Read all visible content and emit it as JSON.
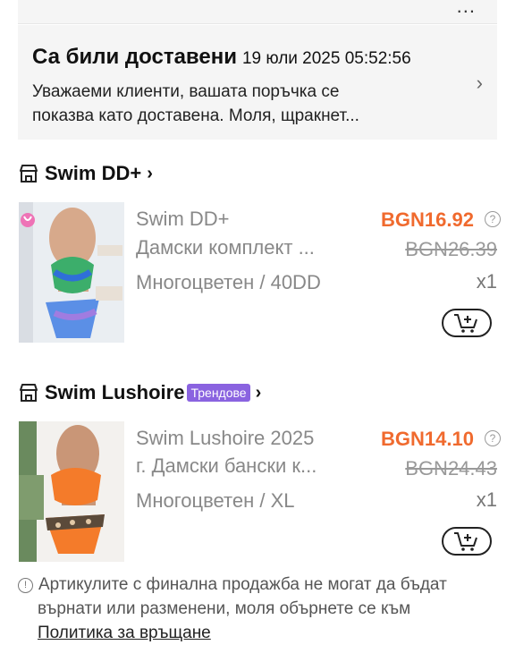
{
  "header": {
    "more_icon": "more-horizontal-icon",
    "more_label": "..."
  },
  "delivery_notice": {
    "title": "Са били доставени",
    "timestamp": "19 юли 2025 05:52:56",
    "line1": "Уважаеми клиенти, вашата поръчка се",
    "line2": "показва като доставена. Моля, щракнет..."
  },
  "orders": [
    {
      "store_name": "Swim DD+",
      "badge": "",
      "product_name_line1": "Swim DD+",
      "product_name_line2": "Дамски комплект ...",
      "variant": "Многоцветен / 40DD",
      "price": "BGN16.92",
      "old_price": "BGN26.39",
      "quantity": "x1"
    },
    {
      "store_name": "Swim Lushoire",
      "badge": "Трендове",
      "product_name_line1": "Swim Lushoire 2025",
      "product_name_line2": "г. Дамски бански к...",
      "variant": "Многоцветен / XL",
      "price": "BGN14.10",
      "old_price": "BGN24.43",
      "quantity": "x1"
    }
  ],
  "footer": {
    "note_line1": "Артикулите с финална продажба не могат да бъдат",
    "note_line2": "върнати или разменени, моля обърнете се към",
    "policy_link": "Политика за връщане"
  },
  "colors": {
    "price": "#f06a2e",
    "badge": "#8a63e0",
    "panel": "#f5f5f5"
  }
}
